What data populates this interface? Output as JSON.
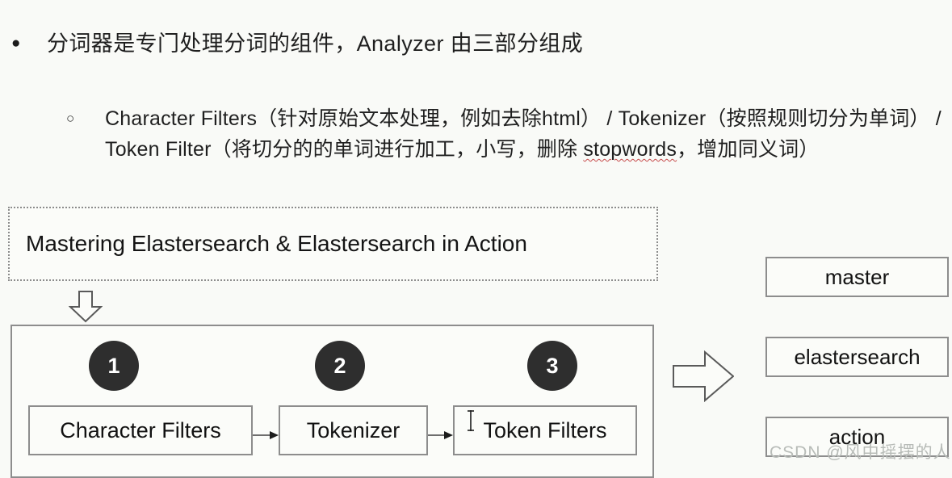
{
  "page": {
    "background": "#f9faf7",
    "text_color": "#1f1f1f"
  },
  "bullets": {
    "level1": {
      "marker": "bullet-filled-dot",
      "marker_glyph": "●",
      "text": "分词器是专门处理分词的组件，Analyzer 由三部分组成"
    },
    "level2": {
      "marker": "bullet-hollow-circle",
      "marker_glyph": "○",
      "segment_1": "Character Filters（针对原始文本处理，例如去除html） / Tokenizer（按照规则切分为单词） / Token Filter（将切分的的单词进行加工，小写，删除 ",
      "spellchecked_word": "stopwords",
      "segment_2": "，增加同义词）",
      "spellcheck_color": "#c74b4b"
    }
  },
  "diagram": {
    "input": {
      "text": "Mastering Elastersearch & Elastersearch in Action",
      "border_style": "dotted",
      "border_color": "#8c8c8c"
    },
    "down_arrow_icon": "arrow-down-outline-icon",
    "right_arrow_icon": "arrow-right-outline-icon",
    "pipeline": {
      "border_color": "#8d8d8d",
      "badge_bg": "#2e2e2e",
      "badge_fg": "#ffffff",
      "steps": [
        {
          "badge": "1",
          "label": "Character Filters"
        },
        {
          "badge": "2",
          "label": "Tokenizer"
        },
        {
          "badge": "3",
          "label": "Token Filters"
        }
      ]
    },
    "tokens": [
      {
        "label": "master"
      },
      {
        "label": "elastersearch"
      },
      {
        "label": "action"
      }
    ]
  },
  "watermark": {
    "text": "CSDN @风中摇摆的人",
    "color": "#b8bcb8"
  }
}
